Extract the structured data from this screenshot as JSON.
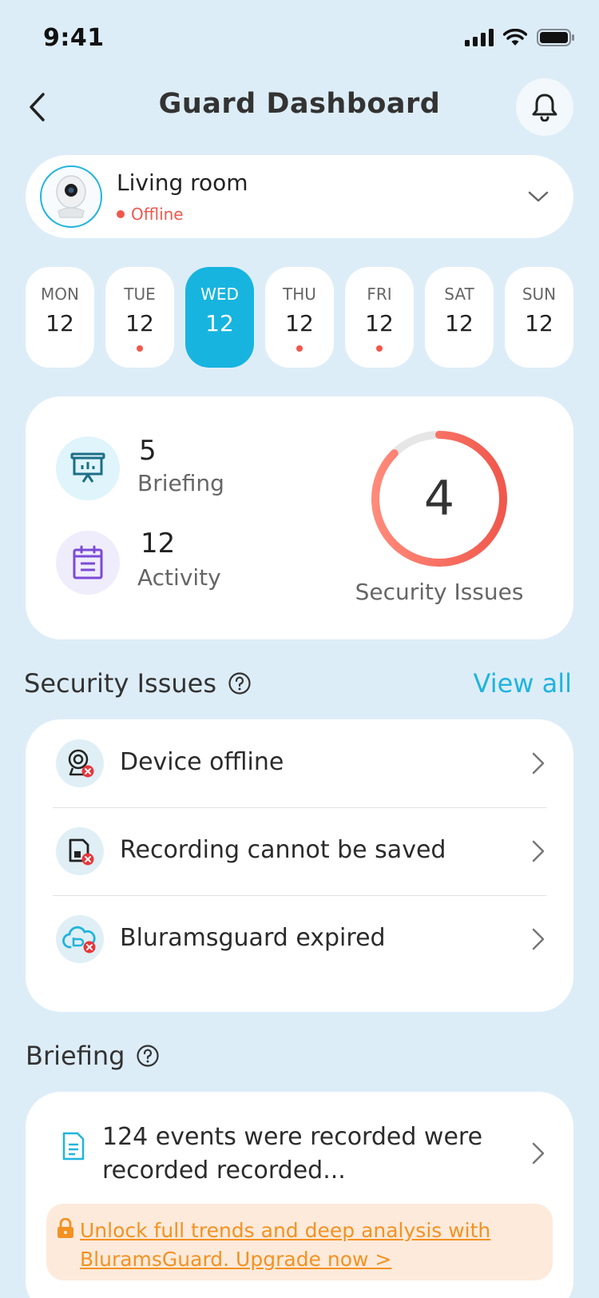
{
  "status_bar": {
    "time": "9:41"
  },
  "header": {
    "title": "Guard Dashboard"
  },
  "device": {
    "name": "Living room",
    "status": "Offline",
    "status_color": "#f0584c"
  },
  "days": [
    {
      "name": "MON",
      "date": "12",
      "active": false,
      "has_event": false
    },
    {
      "name": "TUE",
      "date": "12",
      "active": false,
      "has_event": true
    },
    {
      "name": "WED",
      "date": "12",
      "active": true,
      "has_event": false
    },
    {
      "name": "THU",
      "date": "12",
      "active": false,
      "has_event": true
    },
    {
      "name": "FRI",
      "date": "12",
      "active": false,
      "has_event": true
    },
    {
      "name": "SAT",
      "date": "12",
      "active": false,
      "has_event": false
    },
    {
      "name": "SUN",
      "date": "12",
      "active": false,
      "has_event": false
    }
  ],
  "summary": {
    "briefing": {
      "count": "5",
      "label": "Briefing"
    },
    "activity": {
      "count": "12",
      "label": "Activity"
    },
    "security": {
      "count": "4",
      "label": "Security Issues"
    }
  },
  "issues_section": {
    "title": "Security Issues",
    "view_all": "View all",
    "items": [
      {
        "label": "Device offline",
        "icon": "camera-offline-icon"
      },
      {
        "label": "Recording cannot be saved",
        "icon": "storage-error-icon"
      },
      {
        "label": "Bluramsguard expired",
        "icon": "cloud-expired-icon"
      }
    ]
  },
  "briefing_section": {
    "title": "Briefing",
    "summary_text": "124 events were recorded were recorded recorded...",
    "upgrade_text": "Unlock full trends and deep analysis with BluramsGuard. Upgrade now >"
  },
  "colors": {
    "background": "#ddedf8",
    "accent": "#17b4e0",
    "alert": "#f0584c",
    "upgrade": "#f39222"
  }
}
